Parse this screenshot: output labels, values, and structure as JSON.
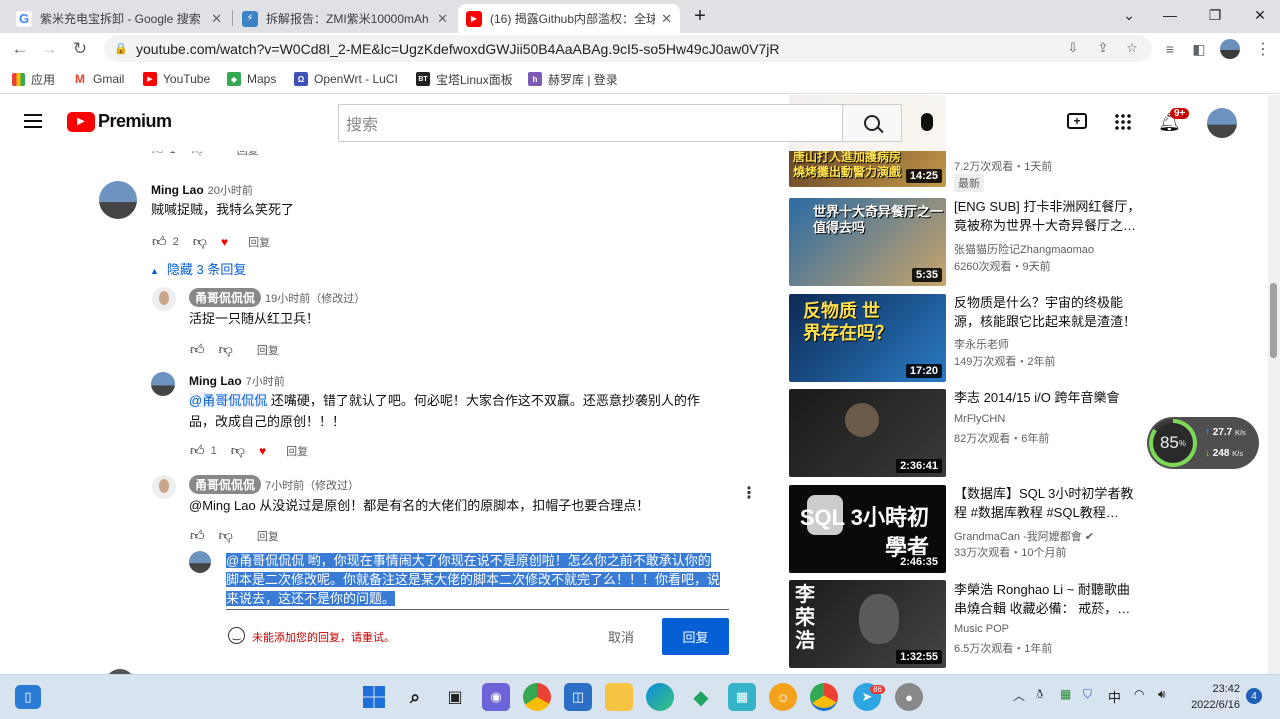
{
  "browser": {
    "tabs": [
      {
        "title": "紫米充电宝拆卸 - Google 搜索",
        "favicon": "google-icon"
      },
      {
        "title": "拆解报告：ZMI紫米10000mAh",
        "favicon": "chongdiantou-icon"
      },
      {
        "title": "(16) 揭露Github内部滥权：全球",
        "favicon": "youtube-icon"
      }
    ],
    "new_tab": "+",
    "url": "youtube.com/watch?v=W0Cd8I_2-ME&lc=UgzKdefwoxdGWJii50B4AaABAg.9cI5-so5Hw49cJ0aw0V7jR",
    "bookmarks": [
      "应用",
      "Gmail",
      "YouTube",
      "Maps",
      "OpenWrt - LuCI",
      "宝塔Linux面板",
      "赫罗库 | 登录"
    ]
  },
  "yt_header": {
    "logo_text": "Premium",
    "search_placeholder": "搜索",
    "notifications_badge": "9+"
  },
  "comments": [
    {
      "name": "Ming Lao",
      "time": "20小时前",
      "text": "贼喊捉贼，我特么笑死了",
      "likes": "2",
      "reply": "回复"
    }
  ],
  "hide_replies": "隐藏 3 条回复",
  "replies": [
    {
      "name": "甬哥侃侃侃",
      "time": "19小时前（修改过）",
      "text": "活捉一只随从红卫兵！",
      "reply": "回复"
    },
    {
      "name": "Ming Lao",
      "time": "7小时前",
      "mention": "@甬哥侃侃侃",
      "text": " 还嘴硬，错了就认了吧。何必呢！大家合作这不双赢。还恶意抄袭别人的作",
      "text2": "品，改成自己的原创！！！",
      "likes": "1",
      "reply": "回复"
    },
    {
      "name": "甬哥侃侃侃",
      "time": "7小时前（修改过）",
      "text": "@Ming Lao 从没说过是原创！都是有名的大佬们的原脚本，扣帽子也要合理点！",
      "reply": "回复"
    }
  ],
  "draft": {
    "line1": "@甬哥侃侃侃 哟，你现在事情闹大了你现在说不是原创啦！怎么你之前不敢承认你的",
    "line2": "脚本是二次修改呢。你就备注这是某大佬的脚本二次修改不就完了么！！！你看吧，说",
    "line3": "来说去，这还不是你的问题。",
    "error": "未能添加您的回复，请重试。",
    "cancel": "取消",
    "submit": "回复"
  },
  "top_partial": {
    "reply": "回复",
    "likes": "1"
  },
  "sidebar": [
    {
      "title": "",
      "channel": "",
      "meta": "7.2万次观看・1天前",
      "badge": "最新",
      "duration": "14:25",
      "thumb_text": "唐山打人進加護病房 燒烤攤出動警力演戲",
      "colors": [
        "#4a2a1a",
        "#c59a4a"
      ]
    },
    {
      "title": "[ENG SUB] 打卡非洲网红餐厅，竟被称为世界十大奇异餐厅之…",
      "channel": "张猫猫历险记Zhangmaomao",
      "meta": "6260次观看・9天前",
      "duration": "5:35",
      "thumb_text": "世界十大奇异餐厅之一 值得去吗",
      "colors": [
        "#2b6ba3",
        "#c9a46a"
      ]
    },
    {
      "title": "反物质是什么？宇宙的终极能源，核能跟它比起来就是渣渣！",
      "channel": "李永乐老师",
      "meta": "149万次观看・2年前",
      "duration": "17:20",
      "thumb_text": "反物质 世界存在吗？",
      "colors": [
        "#0d2a55",
        "#2a7bc4"
      ]
    },
    {
      "title": "李志 2014/15 i/O 跨年音樂會",
      "channel": "MrFlyCHN",
      "meta": "82万次观看・6年前",
      "duration": "2:36:41",
      "thumb_text": "",
      "colors": [
        "#1a1a1a",
        "#3a3a3a"
      ]
    },
    {
      "title": "【数据库】SQL 3小时初学者教程 #数据库教程 #SQL教程…",
      "channel": "GrandmaCan -我阿嬤都會",
      "meta": "33万次观看・10个月前",
      "duration": "2:46:35",
      "thumb_text": "SQL 3小時初學者",
      "colors": [
        "#0a0a0a",
        "#1a1a1a"
      ]
    },
    {
      "title": "李榮浩 Ronghao Li ~ 耐聽歌曲 串燒合輯 收藏必備： 戒菸，…",
      "channel": "Music POP",
      "meta": "6.5万次观看・1年前",
      "duration": "1:32:55",
      "thumb_text": "李 荣 浩",
      "colors": [
        "#1a1a1a",
        "#444"
      ]
    }
  ],
  "net_widget": {
    "percent": "85",
    "unit": "%",
    "up": "27.7",
    "up_unit": "K/s",
    "down": "248",
    "down_unit": "K/s"
  },
  "taskbar": {
    "ime": "中",
    "time": "23:42",
    "date": "2022/6/16",
    "notif": "4",
    "app_badge": "86"
  }
}
